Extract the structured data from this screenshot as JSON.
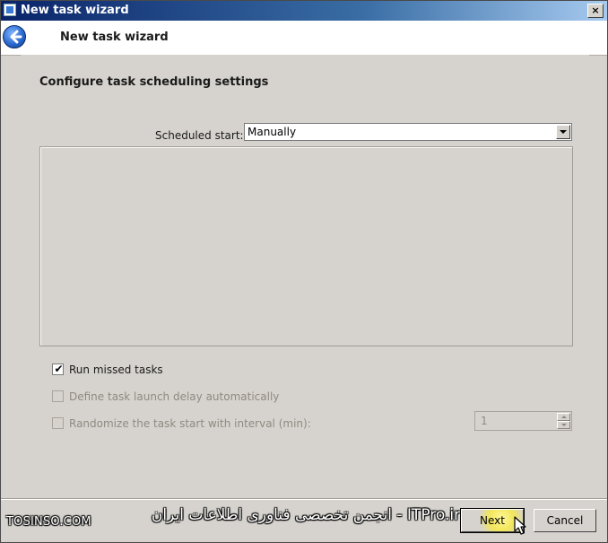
{
  "window": {
    "title": "New task wizard",
    "close_label": "×"
  },
  "header": {
    "title": "New task wizard",
    "back_icon": "back-arrow-icon"
  },
  "main": {
    "section_title": "Configure task scheduling settings",
    "scheduled_start": {
      "label": "Scheduled start:",
      "value": "Manually"
    },
    "options": [
      {
        "label": "Run missed tasks",
        "checked": true,
        "enabled": true
      },
      {
        "label": "Define task launch delay automatically",
        "checked": false,
        "enabled": false
      },
      {
        "label": "Randomize the task start with interval (min):",
        "checked": false,
        "enabled": false
      }
    ],
    "interval_value": "1"
  },
  "footer": {
    "next_label": "Next",
    "cancel_label": "Cancel"
  },
  "watermark": {
    "left_text": "TOSINSO.COM",
    "center_text": "ITPro.ir - انجمن تخصصی فناوری اطلاعات ایران"
  },
  "colors": {
    "titlebar_start": "#0a246a",
    "titlebar_end": "#a6caf0",
    "dialog_bg": "#d6d3ce",
    "header_bg": "#ffffff",
    "highlight": "#f2e65a"
  }
}
